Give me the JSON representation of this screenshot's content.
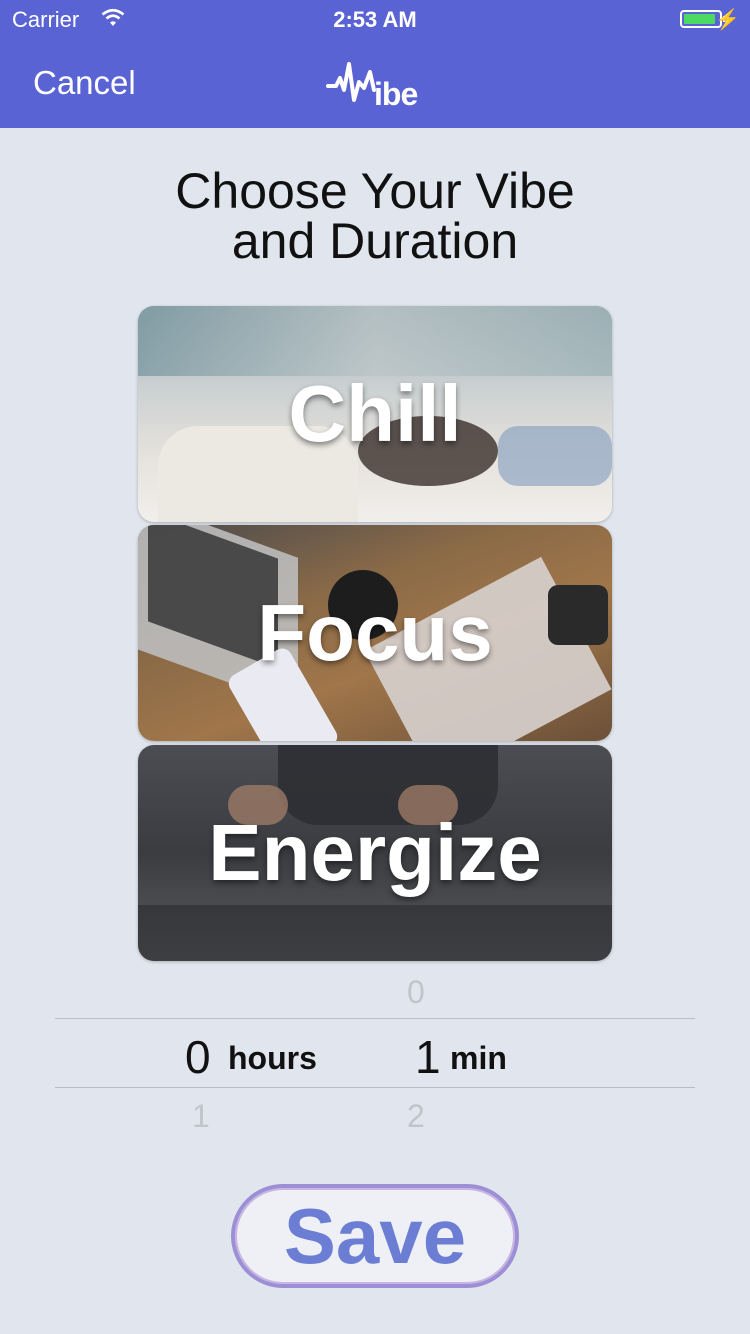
{
  "status_bar": {
    "carrier": "Carrier",
    "time": "2:53 AM",
    "battery_level": 0.9,
    "battery_color": "#4cd964"
  },
  "nav": {
    "cancel_label": "Cancel",
    "logo_text": "ibe",
    "background": "#5a63d3"
  },
  "heading": {
    "line1": "Choose Your Vibe",
    "line2": "and Duration"
  },
  "vibes": [
    {
      "label": "Chill"
    },
    {
      "label": "Focus"
    },
    {
      "label": "Energize"
    }
  ],
  "picker": {
    "hours": {
      "above": "",
      "selected": "0",
      "below": "1",
      "unit": "hours"
    },
    "minutes": {
      "above": "0",
      "selected": "1",
      "below": "2",
      "unit": "min"
    }
  },
  "save_label": "Save"
}
